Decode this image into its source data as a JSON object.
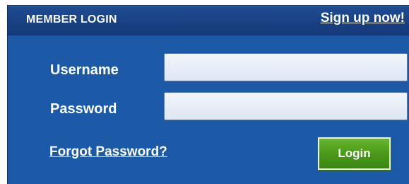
{
  "panel": {
    "title": "MEMBER LOGIN",
    "signup_link": "Sign up now!"
  },
  "form": {
    "username_label": "Username",
    "username_value": "",
    "password_label": "Password",
    "password_value": "",
    "forgot_link": "Forgot Password?",
    "login_button": "Login"
  },
  "colors": {
    "header_bg": "#1a4385",
    "body_bg": "#1c5aa8",
    "button_green": "#4a9a1a",
    "input_bg": "#e8eef7",
    "text": "#ffffff"
  }
}
